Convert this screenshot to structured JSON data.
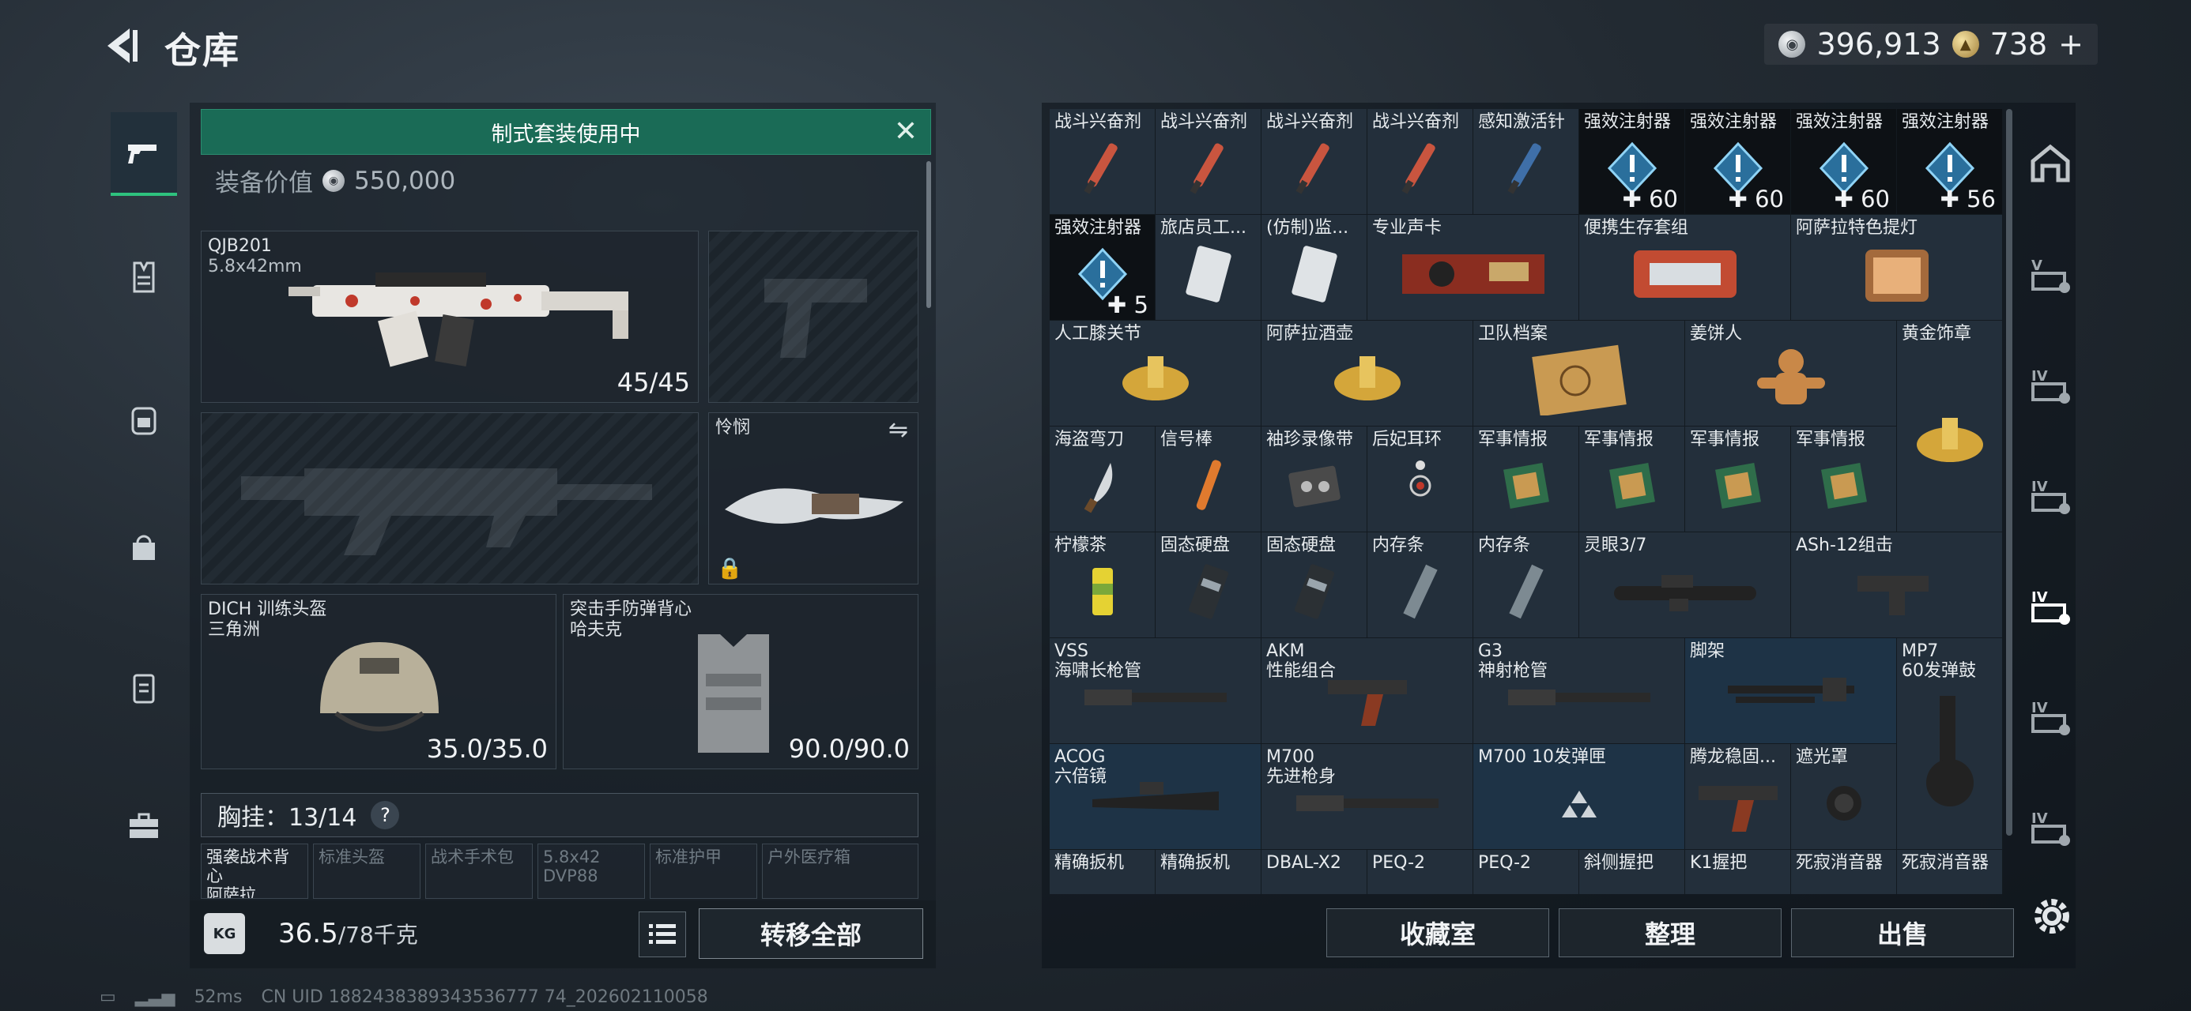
{
  "header": {
    "title": "仓库",
    "currencies": [
      {
        "icon": "silver-coin-icon",
        "value": "396,913"
      },
      {
        "icon": "gold-coin-icon",
        "value": "738"
      }
    ],
    "add_label": "+"
  },
  "left_tabs": [
    {
      "icon": "pistol-icon",
      "active": true
    },
    {
      "icon": "vest-icon"
    },
    {
      "icon": "backpack-icon"
    },
    {
      "icon": "bag-icon"
    },
    {
      "icon": "case-icon"
    },
    {
      "icon": "toolbox-icon"
    }
  ],
  "loadout": {
    "kit_banner": "制式套装使用中",
    "value_label": "装备价值",
    "value": "550,000",
    "primary": {
      "name": "QJB201",
      "ammo": "5.8x42mm",
      "count": "45/45"
    },
    "melee": {
      "name": "怜悯"
    },
    "helmet": {
      "name": "DICH 训练头盔",
      "sub": "三角洲",
      "count": "35.0/35.0"
    },
    "armor": {
      "name": "突击手防弹背心",
      "sub": "哈夫克",
      "count": "90.0/90.0"
    },
    "chest_label": "胸挂：13/14",
    "chest_help": "?",
    "mini_slots": [
      {
        "name": "强袭战术背心",
        "sub": "阿萨拉",
        "filled": true
      },
      {
        "name": "标准头盔",
        "sub": "",
        "filled": false
      },
      {
        "name": "战术手术包",
        "sub": "",
        "filled": false
      },
      {
        "name": "5.8x42",
        "sub": "DVP88",
        "filled": false
      },
      {
        "name": "标准护甲",
        "sub": "",
        "filled": false
      },
      {
        "name": "户外医疗箱",
        "sub": "",
        "filled": false
      }
    ],
    "weight_icon": "KG",
    "weight": "36.5",
    "weight_max": "/78千克",
    "transfer_all": "转移全部"
  },
  "stash": {
    "items": [
      {
        "name": "战斗兴奋剂",
        "qty": "",
        "art": "syringe-red"
      },
      {
        "name": "战斗兴奋剂",
        "qty": "",
        "art": "syringe-red"
      },
      {
        "name": "战斗兴奋剂",
        "qty": "",
        "art": "syringe-red"
      },
      {
        "name": "战斗兴奋剂",
        "qty": "",
        "art": "syringe-red"
      },
      {
        "name": "感知激活针",
        "qty": "",
        "art": "syringe-blue"
      },
      {
        "name": "强效注射器",
        "qty": "60",
        "art": "injector"
      },
      {
        "name": "强效注射器",
        "qty": "60",
        "art": "injector"
      },
      {
        "name": "强效注射器",
        "qty": "60",
        "art": "injector"
      },
      {
        "name": "强效注射器",
        "qty": "56",
        "art": "injector"
      },
      {
        "name": "强效注射器",
        "qty": "5",
        "art": "injector"
      },
      {
        "name": "旅店员工...",
        "qty": "",
        "art": "card"
      },
      {
        "name": "(仿制)监...",
        "qty": "",
        "art": "card"
      },
      {
        "name": "专业声卡",
        "qty": "",
        "art": "soundcard"
      },
      {
        "name": "便携生存套组",
        "qty": "",
        "art": "kit"
      },
      {
        "name": "阿萨拉特色提灯",
        "qty": "",
        "art": "lantern"
      },
      {
        "name": "人工膝关节",
        "qty": "",
        "art": "gold"
      },
      {
        "name": "阿萨拉酒壶",
        "qty": "",
        "art": "gold"
      },
      {
        "name": "卫队档案",
        "qty": "",
        "art": "folder"
      },
      {
        "name": "姜饼人",
        "qty": "",
        "art": "gingerbread"
      },
      {
        "name": "黄金饰章",
        "qty": "",
        "art": "gold"
      },
      {
        "name": "海盗弯刀",
        "qty": "",
        "art": "knife"
      },
      {
        "name": "信号棒",
        "qty": "",
        "art": "flare"
      },
      {
        "name": "袖珍录像带",
        "qty": "",
        "art": "tape"
      },
      {
        "name": "后妃耳环",
        "qty": "",
        "art": "earring"
      },
      {
        "name": "军事情报",
        "qty": "",
        "art": "circuit"
      },
      {
        "name": "军事情报",
        "qty": "",
        "art": "circuit"
      },
      {
        "name": "军事情报",
        "qty": "",
        "art": "circuit"
      },
      {
        "name": "军事情报",
        "qty": "",
        "art": "circuit"
      },
      {
        "name": "柠檬茶",
        "qty": "",
        "art": "can"
      },
      {
        "name": "固态硬盘",
        "qty": "",
        "art": "ssd"
      },
      {
        "name": "固态硬盘",
        "qty": "",
        "art": "ssd"
      },
      {
        "name": "内存条",
        "qty": "",
        "art": "ram"
      },
      {
        "name": "内存条",
        "qty": "",
        "art": "ram"
      },
      {
        "name": "灵眼3/7",
        "qty": "",
        "art": "scope"
      },
      {
        "name": "ASh-12组击",
        "qty": "",
        "art": "stock"
      },
      {
        "name": "VSS",
        "sub": "海啸长枪管",
        "qty": "",
        "art": "barrel"
      },
      {
        "name": "AKM",
        "sub": "性能组合",
        "qty": "",
        "art": "grip"
      },
      {
        "name": "G3",
        "sub": "神射枪管",
        "qty": "",
        "art": "barrel"
      },
      {
        "name": "脚架",
        "qty": "",
        "art": "bipod"
      },
      {
        "name": "MP7",
        "sub": "60发弹鼓",
        "qty": "",
        "art": "drum"
      },
      {
        "name": "ACOG",
        "sub": "六倍镜",
        "qty": "",
        "art": "acog"
      },
      {
        "name": "M700",
        "sub": "先进枪身",
        "qty": "",
        "art": "barrel"
      },
      {
        "name": "M700 10发弹匣",
        "qty": "",
        "art": "emblem"
      },
      {
        "name": "腾龙稳固...",
        "qty": "",
        "art": "grip"
      },
      {
        "name": "遮光罩",
        "qty": "",
        "art": "hood"
      },
      {
        "name": "精确扳机",
        "qty": "",
        "art": "none"
      },
      {
        "name": "精确扳机",
        "qty": "",
        "art": "none"
      },
      {
        "name": "DBAL-X2",
        "qty": "",
        "art": "none"
      },
      {
        "name": "PEQ-2",
        "qty": "",
        "art": "none"
      },
      {
        "name": "PEQ-2",
        "qty": "",
        "art": "none"
      },
      {
        "name": "斜侧握把",
        "qty": "",
        "art": "none"
      },
      {
        "name": "K1握把",
        "qty": "",
        "art": "none"
      },
      {
        "name": "死寂消音器",
        "qty": "",
        "art": "none"
      },
      {
        "name": "死寂消音器",
        "qty": "",
        "art": "none"
      }
    ],
    "buttons": {
      "collection": "收藏室",
      "sort": "整理",
      "sell": "出售"
    }
  },
  "right_tabs": [
    {
      "icon": "storage-room-icon"
    },
    {
      "icon": "v-crate-icon"
    },
    {
      "icon": "iv-crate-icon"
    },
    {
      "icon": "iv-crate-icon"
    },
    {
      "icon": "iv-crate-icon",
      "active": true
    },
    {
      "icon": "iv-crate-icon"
    },
    {
      "icon": "iv-crate-icon"
    }
  ],
  "status": {
    "ping": "52ms",
    "uid": "CN UID 1882438389343536777 74_202602110058"
  }
}
